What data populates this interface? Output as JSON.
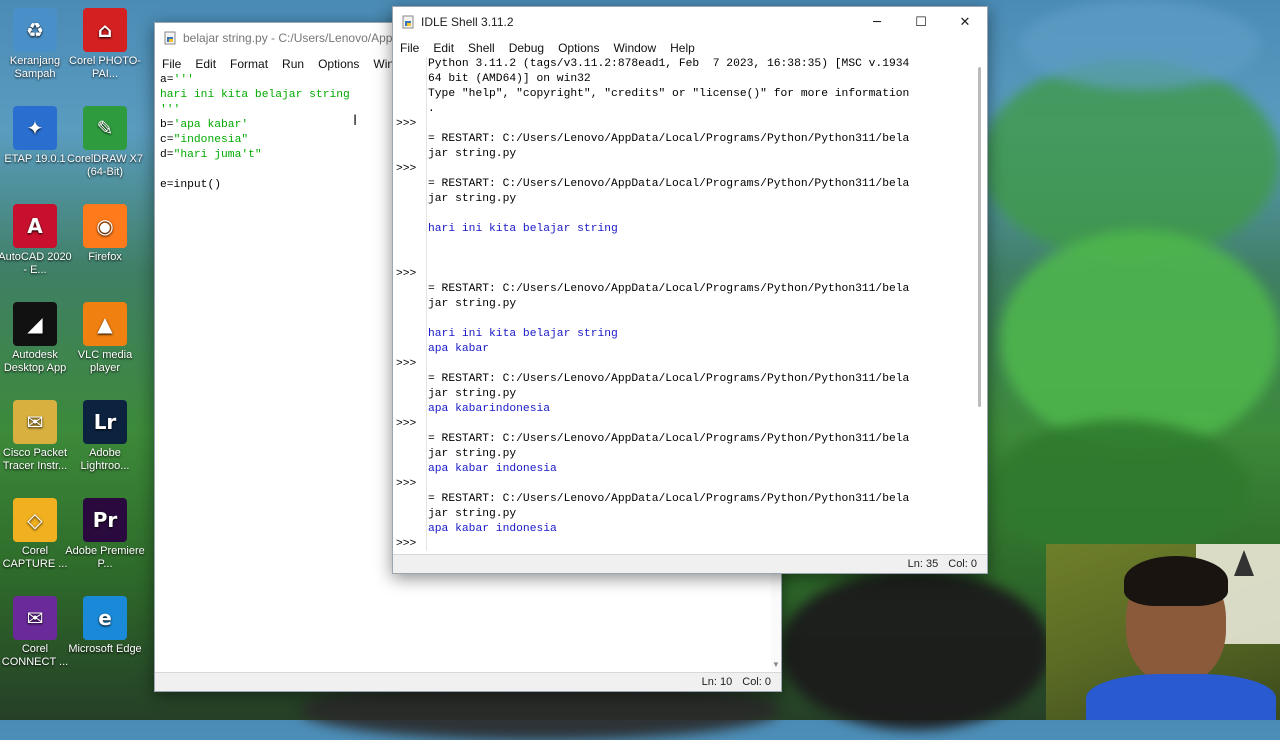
{
  "desktop": {
    "icons": [
      {
        "label": "Keranjang Sampah",
        "icon": "recycle-bin-icon",
        "color": "#4a90c8",
        "glyph": "♻"
      },
      {
        "label": "Corel PHOTO-PAI...",
        "icon": "corel-photopaint-icon",
        "color": "#d42020",
        "glyph": "⌂"
      },
      {
        "label": "ETAP 19.0.1",
        "icon": "etap-icon",
        "color": "#2a6fd0",
        "glyph": "✦"
      },
      {
        "label": "CorelDRAW X7 (64-Bit)",
        "icon": "coreldraw-icon",
        "color": "#2e9b3e",
        "glyph": "✎"
      },
      {
        "label": "AutoCAD 2020 - E...",
        "icon": "autocad-icon",
        "color": "#c8102e",
        "glyph": "A"
      },
      {
        "label": "Firefox",
        "icon": "firefox-icon",
        "color": "#ff7a1a",
        "glyph": "◉"
      },
      {
        "label": "Autodesk Desktop App",
        "icon": "autodesk-icon",
        "color": "#111111",
        "glyph": "◢"
      },
      {
        "label": "VLC media player",
        "icon": "vlc-icon",
        "color": "#f08010",
        "glyph": "▲"
      },
      {
        "label": "Cisco Packet Tracer Instr...",
        "icon": "cisco-packet-tracer-icon",
        "color": "#d8b040",
        "glyph": "✉"
      },
      {
        "label": "Adobe Lightroo...",
        "icon": "lightroom-icon",
        "color": "#0c2340",
        "glyph": "Lr"
      },
      {
        "label": "Corel CAPTURE ...",
        "icon": "corel-capture-icon",
        "color": "#f0b020",
        "glyph": "◇"
      },
      {
        "label": "Adobe Premiere P...",
        "icon": "premiere-icon",
        "color": "#2a0a3e",
        "glyph": "Pr"
      },
      {
        "label": "Corel CONNECT ...",
        "icon": "corel-connect-icon",
        "color": "#6a2a9a",
        "glyph": "✉"
      },
      {
        "label": "Microsoft Edge",
        "icon": "edge-icon",
        "color": "#1a8ad8",
        "glyph": "e"
      }
    ]
  },
  "editor": {
    "title": "belajar string.py - C:/Users/Lenovo/AppDa",
    "menu": [
      "File",
      "Edit",
      "Format",
      "Run",
      "Options",
      "Windo"
    ],
    "lines": [
      [
        {
          "t": "a=",
          "c": "blk"
        },
        {
          "t": "'''",
          "c": "str"
        }
      ],
      [
        {
          "t": "hari ini kita belajar string",
          "c": "str"
        }
      ],
      [
        {
          "t": "'''",
          "c": "str"
        }
      ],
      [
        {
          "t": "b=",
          "c": "blk"
        },
        {
          "t": "'apa kabar'",
          "c": "str"
        }
      ],
      [
        {
          "t": "c=",
          "c": "blk"
        },
        {
          "t": "\"indonesia\"",
          "c": "str"
        }
      ],
      [
        {
          "t": "d=",
          "c": "blk"
        },
        {
          "t": "\"hari juma't\"",
          "c": "str"
        }
      ],
      [
        {
          "t": "",
          "c": "blk"
        }
      ],
      [
        {
          "t": "e=input()",
          "c": "blk"
        }
      ]
    ],
    "status": {
      "ln": "Ln: 10",
      "col": "Col: 0"
    }
  },
  "shell": {
    "title": "IDLE Shell 3.11.2",
    "menu": [
      "File",
      "Edit",
      "Shell",
      "Debug",
      "Options",
      "Window",
      "Help"
    ],
    "lines": [
      {
        "p": "",
        "t": "Python 3.11.2 (tags/v3.11.2:878ead1, Feb  7 2023, 16:38:35) [MSC v.1934",
        "c": "blk"
      },
      {
        "p": "",
        "t": "64 bit (AMD64)] on win32",
        "c": "blk"
      },
      {
        "p": "",
        "t": "Type \"help\", \"copyright\", \"credits\" or \"license()\" for more information",
        "c": "blk"
      },
      {
        "p": "",
        "t": ".",
        "c": "blk"
      },
      {
        "p": ">>>",
        "t": "",
        "c": "blk"
      },
      {
        "p": "",
        "t": "= RESTART: C:/Users/Lenovo/AppData/Local/Programs/Python/Python311/bela",
        "c": "blk"
      },
      {
        "p": "",
        "t": "jar string.py",
        "c": "blk"
      },
      {
        "p": ">>>",
        "t": "",
        "c": "blk"
      },
      {
        "p": "",
        "t": "= RESTART: C:/Users/Lenovo/AppData/Local/Programs/Python/Python311/bela",
        "c": "blk"
      },
      {
        "p": "",
        "t": "jar string.py",
        "c": "blk"
      },
      {
        "p": "",
        "t": "",
        "c": "blk"
      },
      {
        "p": "",
        "t": "hari ini kita belajar string",
        "c": "out"
      },
      {
        "p": "",
        "t": "",
        "c": "blk"
      },
      {
        "p": "",
        "t": "",
        "c": "blk"
      },
      {
        "p": ">>>",
        "t": "",
        "c": "blk"
      },
      {
        "p": "",
        "t": "= RESTART: C:/Users/Lenovo/AppData/Local/Programs/Python/Python311/bela",
        "c": "blk"
      },
      {
        "p": "",
        "t": "jar string.py",
        "c": "blk"
      },
      {
        "p": "",
        "t": "",
        "c": "blk"
      },
      {
        "p": "",
        "t": "hari ini kita belajar string",
        "c": "out"
      },
      {
        "p": "",
        "t": "apa kabar",
        "c": "out"
      },
      {
        "p": ">>>",
        "t": "",
        "c": "blk"
      },
      {
        "p": "",
        "t": "= RESTART: C:/Users/Lenovo/AppData/Local/Programs/Python/Python311/bela",
        "c": "blk"
      },
      {
        "p": "",
        "t": "jar string.py",
        "c": "blk"
      },
      {
        "p": "",
        "t": "apa kabarindonesia",
        "c": "out"
      },
      {
        "p": ">>>",
        "t": "",
        "c": "blk"
      },
      {
        "p": "",
        "t": "= RESTART: C:/Users/Lenovo/AppData/Local/Programs/Python/Python311/bela",
        "c": "blk"
      },
      {
        "p": "",
        "t": "jar string.py",
        "c": "blk"
      },
      {
        "p": "",
        "t": "apa kabar indonesia",
        "c": "out"
      },
      {
        "p": ">>>",
        "t": "",
        "c": "blk"
      },
      {
        "p": "",
        "t": "= RESTART: C:/Users/Lenovo/AppData/Local/Programs/Python/Python311/bela",
        "c": "blk"
      },
      {
        "p": "",
        "t": "jar string.py",
        "c": "blk"
      },
      {
        "p": "",
        "t": "apa kabar indonesia",
        "c": "out"
      },
      {
        "p": ">>>",
        "t": "",
        "c": "blk"
      },
      {
        "p": "",
        "t": "= RESTART: C:/Users/Lenovo/AppData/Local/Programs/Python/Python311/bela",
        "c": "blk"
      }
    ],
    "status": {
      "ln": "Ln: 35",
      "col": "Col: 0"
    }
  }
}
